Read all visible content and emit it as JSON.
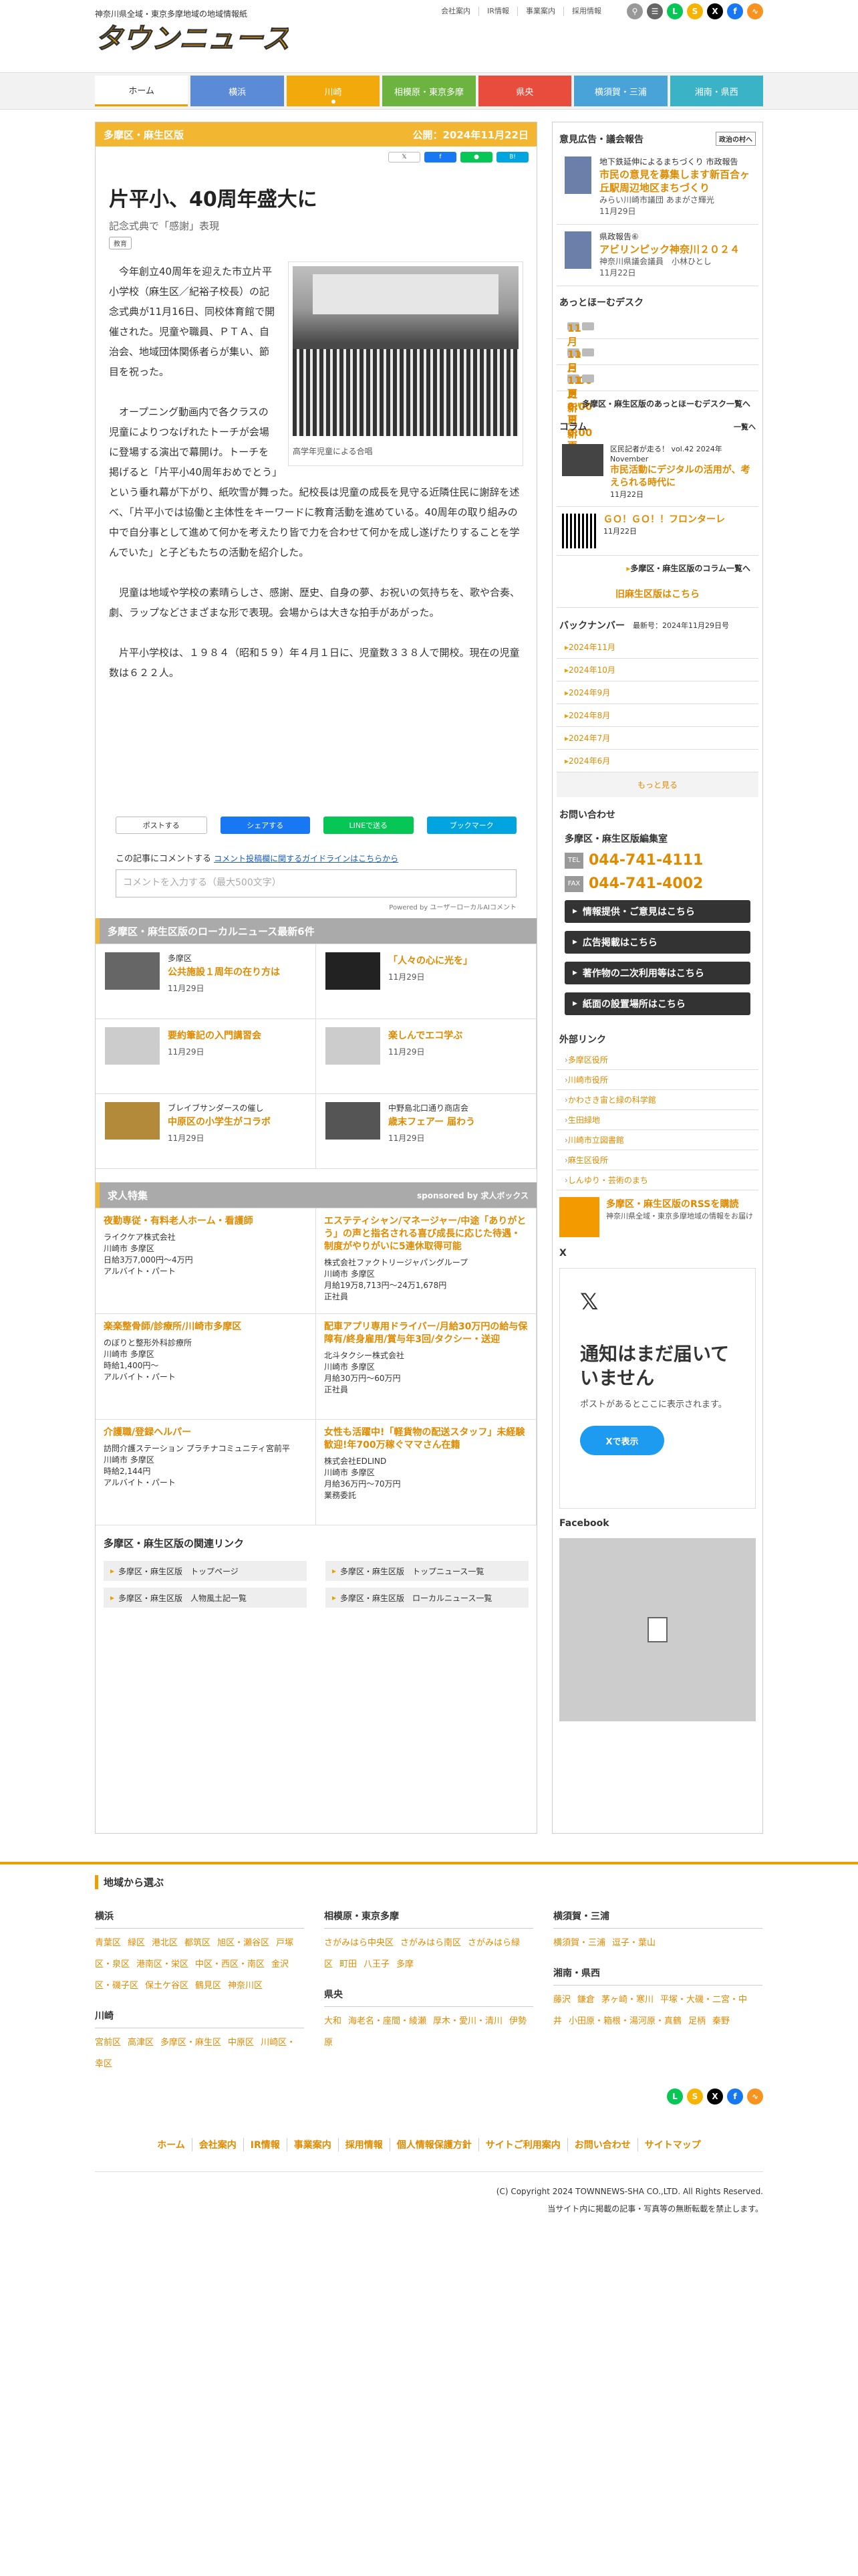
{
  "header": {
    "tagline": "神奈川県全域・東京多摩地域の地域情報紙",
    "logo_text": "タウンニュース",
    "links": [
      "会社案内",
      "IR情報",
      "事業案内",
      "採用情報"
    ]
  },
  "nav": [
    {
      "label": "ホーム",
      "color": "#ffffff"
    },
    {
      "label": "横浜",
      "color": "#5b8bd6"
    },
    {
      "label": "川崎",
      "color": "#f1a90b"
    },
    {
      "label": "相模原・東京多摩",
      "color": "#6cb33f"
    },
    {
      "label": "県央",
      "color": "#e84c3d"
    },
    {
      "label": "横須賀・三浦",
      "color": "#4aa3d8"
    },
    {
      "label": "湘南・県西",
      "color": "#3bb3c6"
    }
  ],
  "article": {
    "section": "多摩区・麻生区版",
    "published": "公開：2024年11月22日",
    "title": "片平小、40周年盛大に",
    "subtitle": "記念式典で「感謝」表現",
    "tag": "教育",
    "photo_caption": "高学年児童による合唱",
    "paragraphs": [
      "今年創立40周年を迎えた市立片平小学校（麻生区／紀裕子校長）の記念式典が11月16日、同校体育館で開催された。児童や職員、ＰＴＡ、自治会、地域団体関係者らが集い、節目を祝った。",
      "オープニング動画内で各クラスの児童によりつなげれたトーチが会場に登場する演出で幕開け。トーチを掲げると「片平小40周年おめでとう」という垂れ幕が下がり、紙吹雪が舞った。紀校長は児童の成長を見守る近隣住民に謝辞を述べ、「片平小では協働と主体性をキーワードに教育活動を進めている。40周年の取り組みの中で自分事として進めて何かを考えたり皆で力を合わせて何かを成し遂げたりすることを学んでいた」と子どもたちの活動を紹介した。",
      "児童は地域や学校の素晴らしさ、感謝、歴史、自身の夢、お祝いの気持ちを、歌や合奏、劇、ラップなどさまざまな形で表現。会場からは大きな拍手があがった。",
      "片平小学校は、１９８４（昭和５９）年４月１日に、児童数３３８人で開校。現在の児童数は６２２人。"
    ]
  },
  "share": {
    "x": "ポストする",
    "fb": "シェアする",
    "line": "LINEで送る",
    "hatena": "ブックマーク"
  },
  "comment": {
    "lead": "この記事にコメントする",
    "guide": "コメント投稿欄に関するガイドラインはこちらから",
    "placeholder": "コメントを入力する（最大500文字）",
    "powered": "Powered by ユーザーローカルAIコメント"
  },
  "local": {
    "heading": "多摩区・麻生区版のローカルニュース最新6件",
    "items": [
      {
        "area": "多摩区",
        "title": "公共施設１周年の在り方は",
        "date": "11月29日"
      },
      {
        "area": "",
        "title": "「人々の心に光を」",
        "date": "11月29日"
      },
      {
        "area": "",
        "title": "要約筆記の入門講習会",
        "date": "11月29日"
      },
      {
        "area": "",
        "title": "楽しんでエコ学ぶ",
        "date": "11月29日"
      },
      {
        "area": "ブレイブサンダースの催し",
        "title": "中原区の小学生がコラボ",
        "date": "11月29日"
      },
      {
        "area": "中野島北口通り商店会",
        "title": "歳末フェアー 届わう",
        "date": "11月29日"
      }
    ]
  },
  "jobs": {
    "heading": "求人特集",
    "sponsor": "sponsored by 求人ボックス",
    "items": [
      {
        "title": "夜勤専従・有料老人ホーム・看護師",
        "company": "ライクケア株式会社",
        "place": "川崎市 多摩区",
        "pay": "日給3万7,000円～4万円",
        "type": "アルバイト・パート"
      },
      {
        "title": "エステティシャン/マネージャー/中途「ありがとう」の声と指名される喜び成長に応じた待遇・制度がやりがいに5連休取得可能",
        "company": "株式会社ファクトリージャパングループ",
        "place": "川崎市 多摩区",
        "pay": "月給19万8,713円～24万1,678円",
        "type": "正社員"
      },
      {
        "title": "楽楽整骨師/診療所/川崎市多摩区",
        "company": "のぼりと整形外科診療所",
        "place": "川崎市 多摩区",
        "pay": "時給1,400円～",
        "type": "アルバイト・パート"
      },
      {
        "title": "配車アプリ専用ドライバー/月給30万円の給与保障有/終身雇用/賞与年3回/タクシー・送迎",
        "company": "北斗タクシー株式会社",
        "place": "川崎市 多摩区",
        "pay": "月給30万円～60万円",
        "type": "正社員"
      },
      {
        "title": "介護職/登録ヘルパー",
        "company": "訪問介護ステーション プラチナコミュニティ宮前平",
        "place": "川崎市 多摩区",
        "pay": "時給2,144円",
        "type": "アルバイト・パート"
      },
      {
        "title": "女性も活躍中!「軽貨物の配送スタッフ」未経験歓迎!年700万稼ぐママさん在籍",
        "company": "株式会社EDLIND",
        "place": "川崎市 多摩区",
        "pay": "月給36万円～70万円",
        "type": "業務委託"
      }
    ]
  },
  "related": {
    "heading": "多摩区・麻生区版の関連リンク",
    "links": [
      "多摩区・麻生区版　トップページ",
      "多摩区・麻生区版　トップニュース一覧",
      "多摩区・麻生区版　人物風土記一覧",
      "多摩区・麻生区版　ローカルニュース一覧"
    ]
  },
  "sidebar": {
    "opinion_heading": "意見広告・議会報告",
    "opinion_more": "政治の村へ",
    "opinions": [
      {
        "lead": "地下鉄延伸によるまちづくり 市政報告",
        "title": "市民の意見を募集します新百合ヶ丘駅周辺地区まちづくり",
        "author": "みらい川崎市議団 あまがさ輝光",
        "date": "11月29日"
      },
      {
        "lead": "県政報告⑥",
        "title": "アビリンピック神奈川２０２４",
        "author": "神奈川県議会議員　小林ひとし",
        "date": "11月22日"
      }
    ],
    "hotdesk_heading": "あっとほーむデスク",
    "hotdesk": [
      "11月29日0:00更新",
      "11月15日0:00更新",
      "11月8日0:00更新"
    ],
    "hotdesk_more": "多摩区・麻生区版のあっとほーむデスク一覧へ",
    "column_heading": "コラム",
    "column_more": "一覧へ",
    "columns": [
      {
        "lead": "区民記者が走る！ vol.42 2024年November",
        "title": "市民活動にデジタルの活用が、考えられる時代に",
        "date": "11月22日"
      },
      {
        "lead": "",
        "title": "ＧＯ！ＧＯ！！フロンターレ",
        "date": "11月22日"
      }
    ],
    "column_list": "多摩区・麻生区版のコラム一覧へ",
    "old_site": "旧麻生区版はこちら",
    "backnumber_heading": "バックナンバー",
    "backnumber_latest": "最新号：2024年11月29日号",
    "backnumbers": [
      "2024年11月",
      "2024年10月",
      "2024年9月",
      "2024年8月",
      "2024年7月",
      "2024年6月"
    ],
    "more": "もっと見る",
    "contact_heading": "お問い合わせ",
    "contact_name": "多摩区・麻生区版編集室",
    "tel_label": "TEL",
    "tel": "044-741-4111",
    "fax_label": "FAX",
    "fax": "044-741-4002",
    "contact_buttons": [
      "情報提供・ご意見はこちら",
      "広告掲載はこちら",
      "著作物の二次利用等はこちら",
      "紙面の設置場所はこちら"
    ],
    "ext_heading": "外部リンク",
    "ext_links": [
      "多摩区役所",
      "川崎市役所",
      "かわさき宙と緑の科学館",
      "生田緑地",
      "川崎市立図書館",
      "麻生区役所",
      "しんゆり・芸術のまち"
    ],
    "rss_title": "多摩区・麻生区版のRSSを購読",
    "rss_desc": "神奈川県全域・東京多摩地域の情報をお届け",
    "x_heading": "X",
    "x_title": "通知はまだ届いていません",
    "x_desc": "ポストがあるとここに表示されます。",
    "x_button": "Xで表示",
    "fb_heading": "Facebook"
  },
  "footer": {
    "heading": "地域から選ぶ",
    "cols": [
      {
        "groups": [
          {
            "title": "横浜",
            "links": [
              "青葉区",
              "緑区",
              "港北区",
              "都筑区",
              "旭区・瀬谷区",
              "戸塚区・泉区",
              "港南区・栄区",
              "中区・西区・南区",
              "金沢区・磯子区",
              "保土ケ谷区",
              "鶴見区",
              "神奈川区"
            ]
          },
          {
            "title": "川崎",
            "links": [
              "宮前区",
              "高津区",
              "多摩区・麻生区",
              "中原区",
              "川崎区・幸区"
            ]
          }
        ]
      },
      {
        "groups": [
          {
            "title": "相模原・東京多摩",
            "links": [
              "さがみはら中央区",
              "さがみはら南区",
              "さがみはら緑区",
              "町田",
              "八王子",
              "多摩"
            ]
          },
          {
            "title": "県央",
            "links": [
              "大和",
              "海老名・座間・綾瀬",
              "厚木・愛川・清川",
              "伊勢原"
            ]
          }
        ]
      },
      {
        "groups": [
          {
            "title": "横須賀・三浦",
            "links": [
              "横須賀・三浦",
              "逗子・葉山"
            ]
          },
          {
            "title": "湘南・県西",
            "links": [
              "藤沢",
              "鎌倉",
              "茅ヶ崎・寒川",
              "平塚・大磯・二宮・中井",
              "小田原・箱根・湯河原・真鶴",
              "足柄",
              "秦野"
            ]
          }
        ]
      }
    ],
    "nav": [
      "ホーム",
      "会社案内",
      "IR情報",
      "事業案内",
      "採用情報",
      "個人情報保護方針",
      "サイトご利用案内",
      "お問い合わせ",
      "サイトマップ"
    ],
    "copyright": "(C) Copyright 2024 TOWNNEWS-SHA CO.,LTD. All Rights Reserved.",
    "notice": "当サイト内に掲載の記事・写真等の無断転載を禁止します。"
  }
}
